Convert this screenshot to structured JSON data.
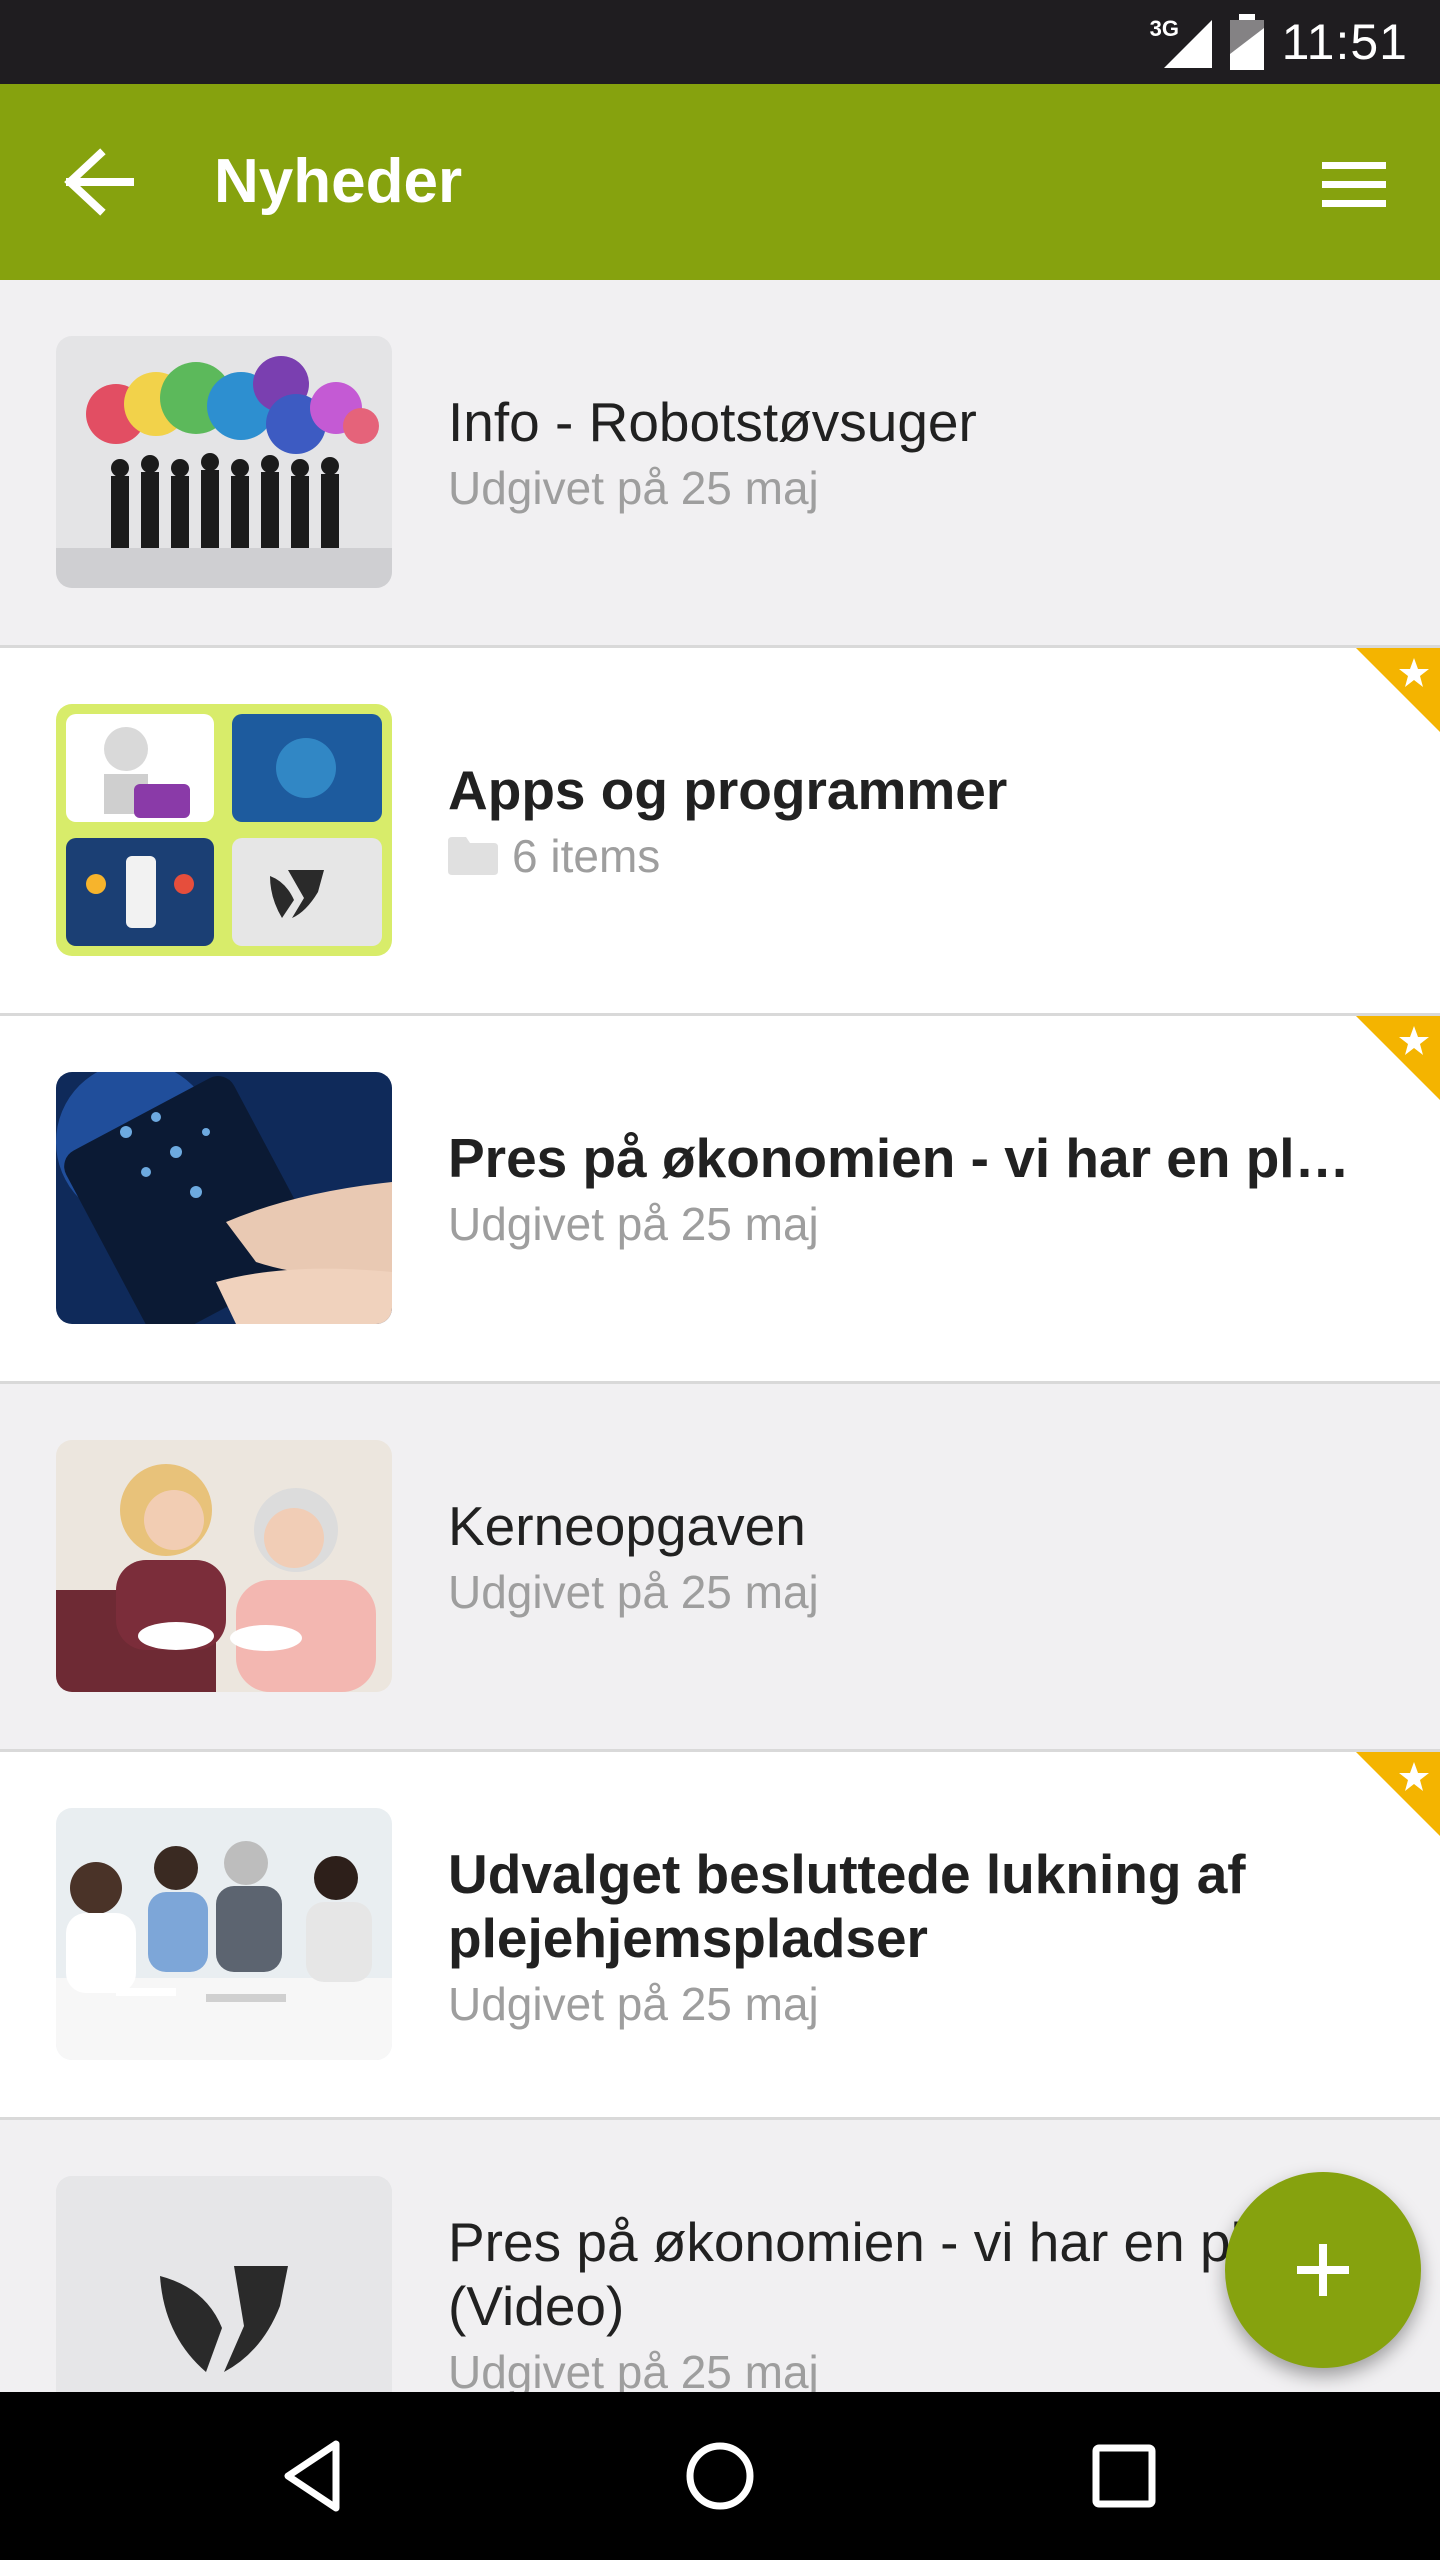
{
  "status_bar": {
    "network": "3G",
    "time": "11:51"
  },
  "app_bar": {
    "title": "Nyheder",
    "back_icon": "arrow-back-icon",
    "menu_icon": "hamburger-menu-icon"
  },
  "news_items": [
    {
      "title": "Info - Robotstøvsuger",
      "subtitle": "Udgivet på 25 maj",
      "bold": false,
      "starred": false
    },
    {
      "title": "Apps og programmer",
      "subtitle": "6 items",
      "bold": true,
      "starred": true,
      "is_folder": true
    },
    {
      "title": "Pres på økonomien - vi har en plan…",
      "subtitle": "Udgivet på 25 maj",
      "bold": true,
      "starred": true
    },
    {
      "title": "Kerneopgaven",
      "subtitle": "Udgivet på 25 maj",
      "bold": false,
      "starred": false
    },
    {
      "title": "Udvalget besluttede lukning af plejehjemspladser",
      "subtitle": "Udgivet på 25 maj",
      "bold": true,
      "starred": true
    },
    {
      "title": "Pres på økonomien - vi har en plan (Video)",
      "subtitle": "Udgivet på 25 maj",
      "bold": false,
      "starred": false
    }
  ],
  "fab": {
    "icon": "plus-icon"
  },
  "nav_bar": {
    "back_icon": "nav-back-icon",
    "home_icon": "nav-home-icon",
    "recents_icon": "nav-recents-icon"
  },
  "colors": {
    "brand_green": "#86a20e",
    "star_badge": "#f4b400",
    "status_bar": "#1f1d20",
    "row_alt_bg": "#f1f0f2"
  }
}
